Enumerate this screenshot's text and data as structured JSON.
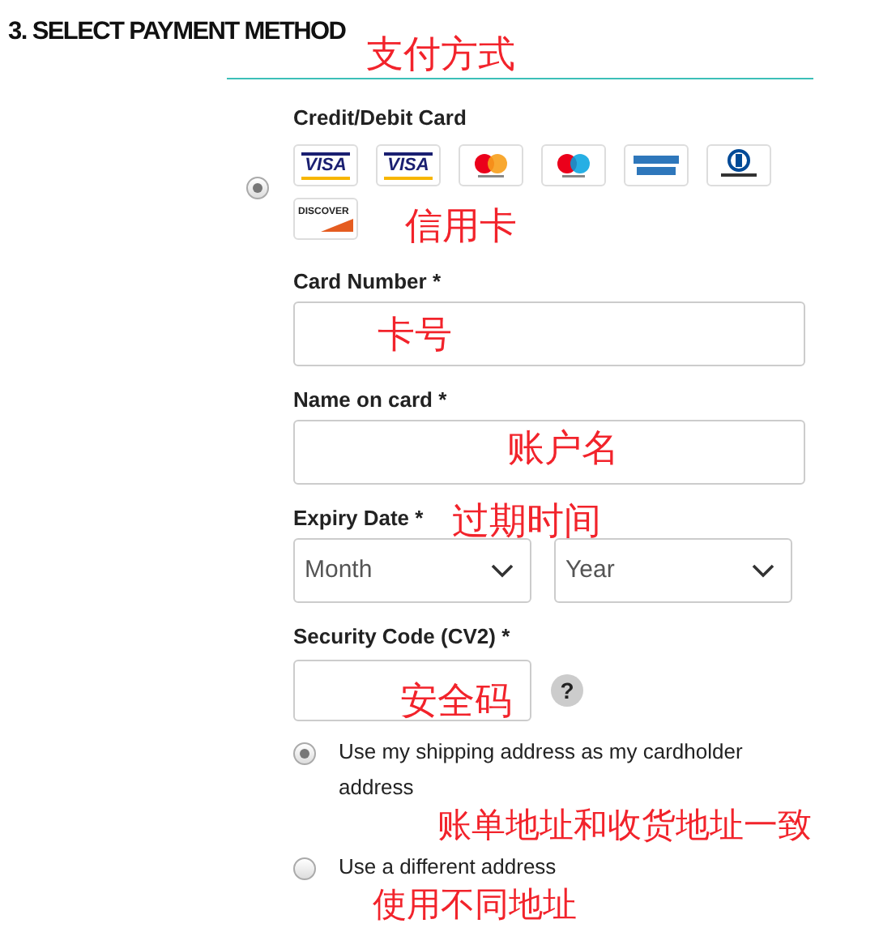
{
  "heading": "3. SELECT PAYMENT METHOD",
  "method": {
    "label": "Credit/Debit Card",
    "selected": true,
    "cards": [
      {
        "kind": "visa",
        "label": "VISA"
      },
      {
        "kind": "visa",
        "label": "VISA"
      },
      {
        "kind": "mastercard"
      },
      {
        "kind": "maestro"
      },
      {
        "kind": "amex"
      },
      {
        "kind": "diners"
      },
      {
        "kind": "discover",
        "label": "DISCOVER"
      }
    ]
  },
  "fields": [
    {
      "kind": "text",
      "label": "Card Number *"
    },
    {
      "kind": "text",
      "label": "Name on card *"
    },
    {
      "kind": "selects",
      "label": "Expiry Date *",
      "options": [
        "Month",
        "Year"
      ]
    },
    {
      "kind": "cvv",
      "label": "Security Code (CV2) *",
      "help": "?"
    }
  ],
  "address_options": [
    {
      "label": "Use my shipping address as my cardholder address",
      "selected": true
    },
    {
      "label": "Use a different address",
      "selected": false
    }
  ],
  "annotations": [
    {
      "text": "支付方式"
    },
    {
      "text": "信用卡"
    },
    {
      "text": "卡号"
    },
    {
      "text": "账户名"
    },
    {
      "text": "过期时间"
    },
    {
      "text": "安全码"
    },
    {
      "text": "账单地址和收货地址一致"
    },
    {
      "text": "使用不同地址"
    }
  ]
}
